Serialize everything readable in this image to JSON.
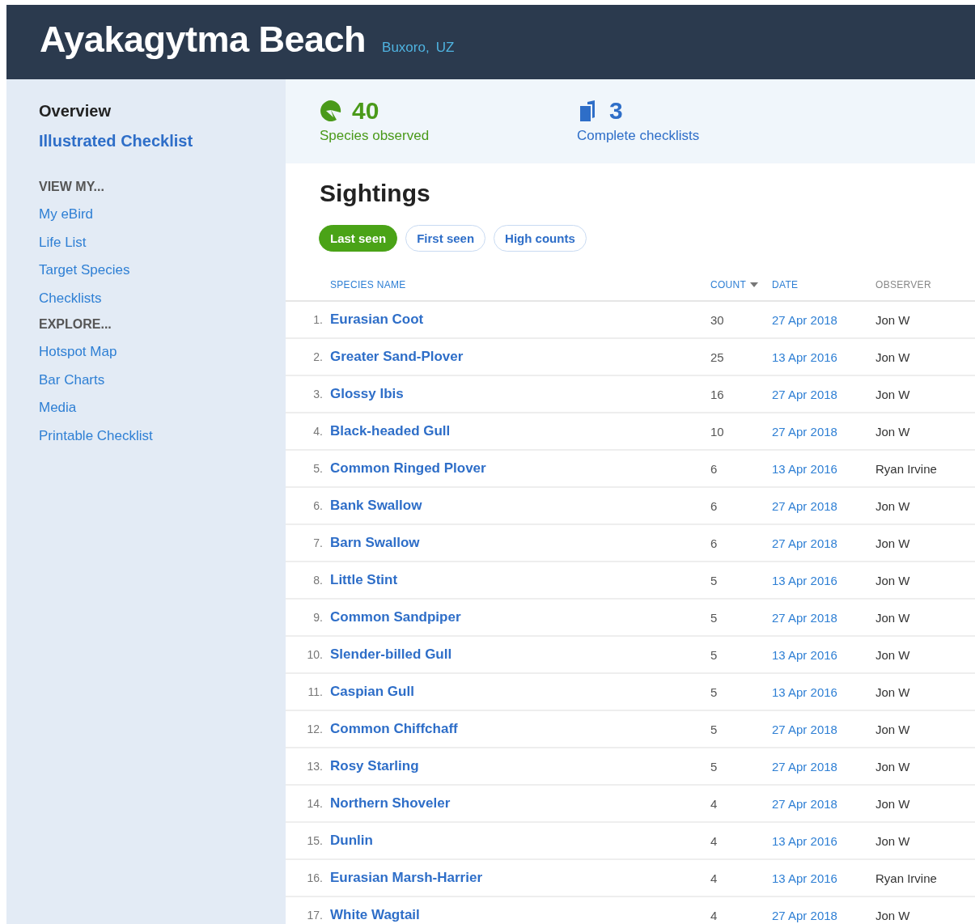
{
  "header": {
    "title": "Ayakagytma Beach",
    "region": "Buxoro",
    "separator": ",",
    "country": "UZ"
  },
  "sidebar": {
    "main_items": [
      {
        "label": "Overview",
        "selected": true
      },
      {
        "label": "Illustrated Checklist",
        "selected": false
      }
    ],
    "sections": [
      {
        "heading": "VIEW MY...",
        "items": [
          "My eBird",
          "Life List",
          "Target Species",
          "Checklists"
        ]
      },
      {
        "heading": "EXPLORE...",
        "items": [
          "Hotspot Map",
          "Bar Charts",
          "Media",
          "Printable Checklist"
        ]
      }
    ]
  },
  "stats": [
    {
      "kind": "species",
      "value": "40",
      "label": "Species observed"
    },
    {
      "kind": "checklists",
      "value": "3",
      "label": "Complete checklists"
    }
  ],
  "sightings": {
    "title": "Sightings",
    "tabs": [
      {
        "label": "Last seen",
        "selected": true
      },
      {
        "label": "First seen",
        "selected": false
      },
      {
        "label": "High counts",
        "selected": false
      }
    ],
    "columns": [
      {
        "label": "SPECIES NAME",
        "sortable": true,
        "sorted": false
      },
      {
        "label": "COUNT",
        "sortable": true,
        "sorted": true
      },
      {
        "label": "DATE",
        "sortable": true,
        "sorted": false
      },
      {
        "label": "OBSERVER",
        "sortable": false,
        "sorted": false
      }
    ],
    "rows": [
      {
        "rank": "1.",
        "species": "Eurasian Coot",
        "count": "30",
        "date": "27 Apr 2018",
        "observer": "Jon W"
      },
      {
        "rank": "2.",
        "species": "Greater Sand-Plover",
        "count": "25",
        "date": "13 Apr 2016",
        "observer": "Jon W"
      },
      {
        "rank": "3.",
        "species": "Glossy Ibis",
        "count": "16",
        "date": "27 Apr 2018",
        "observer": "Jon W"
      },
      {
        "rank": "4.",
        "species": "Black-headed Gull",
        "count": "10",
        "date": "27 Apr 2018",
        "observer": "Jon W"
      },
      {
        "rank": "5.",
        "species": "Common Ringed Plover",
        "count": "6",
        "date": "13 Apr 2016",
        "observer": "Ryan Irvine"
      },
      {
        "rank": "6.",
        "species": "Bank Swallow",
        "count": "6",
        "date": "27 Apr 2018",
        "observer": "Jon W"
      },
      {
        "rank": "7.",
        "species": "Barn Swallow",
        "count": "6",
        "date": "27 Apr 2018",
        "observer": "Jon W"
      },
      {
        "rank": "8.",
        "species": "Little Stint",
        "count": "5",
        "date": "13 Apr 2016",
        "observer": "Jon W"
      },
      {
        "rank": "9.",
        "species": "Common Sandpiper",
        "count": "5",
        "date": "27 Apr 2018",
        "observer": "Jon W"
      },
      {
        "rank": "10.",
        "species": "Slender-billed Gull",
        "count": "5",
        "date": "13 Apr 2016",
        "observer": "Jon W"
      },
      {
        "rank": "11.",
        "species": "Caspian Gull",
        "count": "5",
        "date": "13 Apr 2016",
        "observer": "Jon W"
      },
      {
        "rank": "12.",
        "species": "Common Chiffchaff",
        "count": "5",
        "date": "27 Apr 2018",
        "observer": "Jon W"
      },
      {
        "rank": "13.",
        "species": "Rosy Starling",
        "count": "5",
        "date": "27 Apr 2018",
        "observer": "Jon W"
      },
      {
        "rank": "14.",
        "species": "Northern Shoveler",
        "count": "4",
        "date": "27 Apr 2018",
        "observer": "Jon W"
      },
      {
        "rank": "15.",
        "species": "Dunlin",
        "count": "4",
        "date": "13 Apr 2016",
        "observer": "Jon W"
      },
      {
        "rank": "16.",
        "species": "Eurasian Marsh-Harrier",
        "count": "4",
        "date": "13 Apr 2016",
        "observer": "Ryan Irvine"
      },
      {
        "rank": "17.",
        "species": "White Wagtail",
        "count": "4",
        "date": "27 Apr 2018",
        "observer": "Jon W"
      }
    ]
  }
}
